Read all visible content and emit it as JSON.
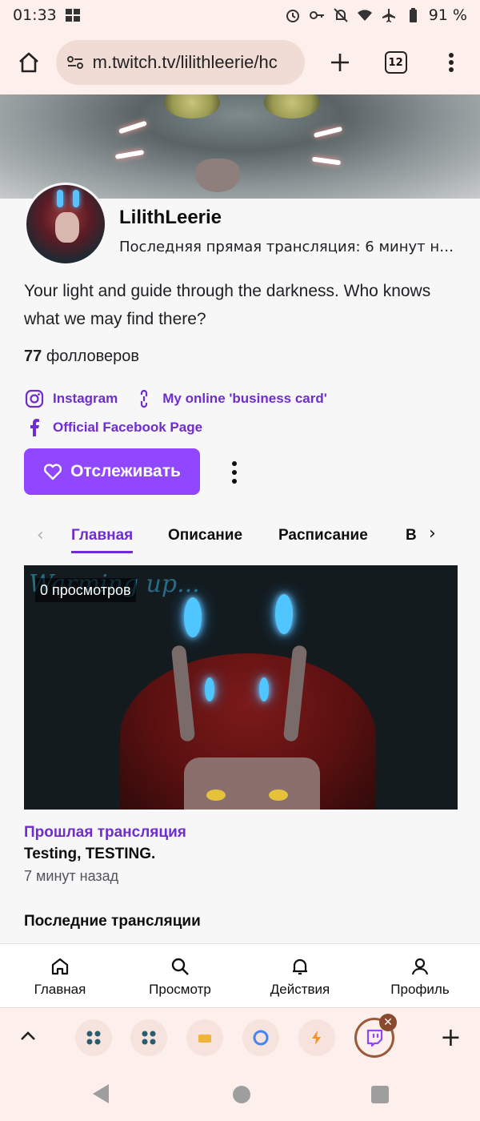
{
  "status_bar": {
    "time": "01:33",
    "battery": "91 %"
  },
  "browser": {
    "url": "m.twitch.tv/lilithleerie/hc",
    "tab_count": "12"
  },
  "profile": {
    "channel_name": "LilithLeerie",
    "last_stream": "Последняя прямая трансляция: 6 минут назад",
    "bio": "Your light and guide through the darkness. Who knows what we may find there?",
    "followers_count": "77",
    "followers_label": "фолловеров",
    "links": [
      {
        "label": "Instagram",
        "icon": "instagram-icon"
      },
      {
        "label": "My online 'business card'",
        "icon": "link-icon"
      },
      {
        "label": "Official Facebook Page",
        "icon": "facebook-icon"
      }
    ],
    "follow_label": "Отслеживать"
  },
  "tabs": [
    "Главная",
    "Описание",
    "Расписание",
    "В"
  ],
  "video": {
    "views": "0 просмотров",
    "watermark": "Warming up..."
  },
  "past_stream": {
    "label": "Прошлая трансляция",
    "title": "Testing, TESTING.",
    "time": "7 минут назад"
  },
  "section": {
    "recent_title": "Последние трансляции"
  },
  "bottom_nav": [
    {
      "label": "Главная",
      "icon": "home-icon"
    },
    {
      "label": "Просмотр",
      "icon": "search-icon"
    },
    {
      "label": "Действия",
      "icon": "bell-icon"
    },
    {
      "label": "Профиль",
      "icon": "user-icon"
    }
  ],
  "colors": {
    "accent": "#9147ff",
    "link": "#6f2ccf"
  }
}
